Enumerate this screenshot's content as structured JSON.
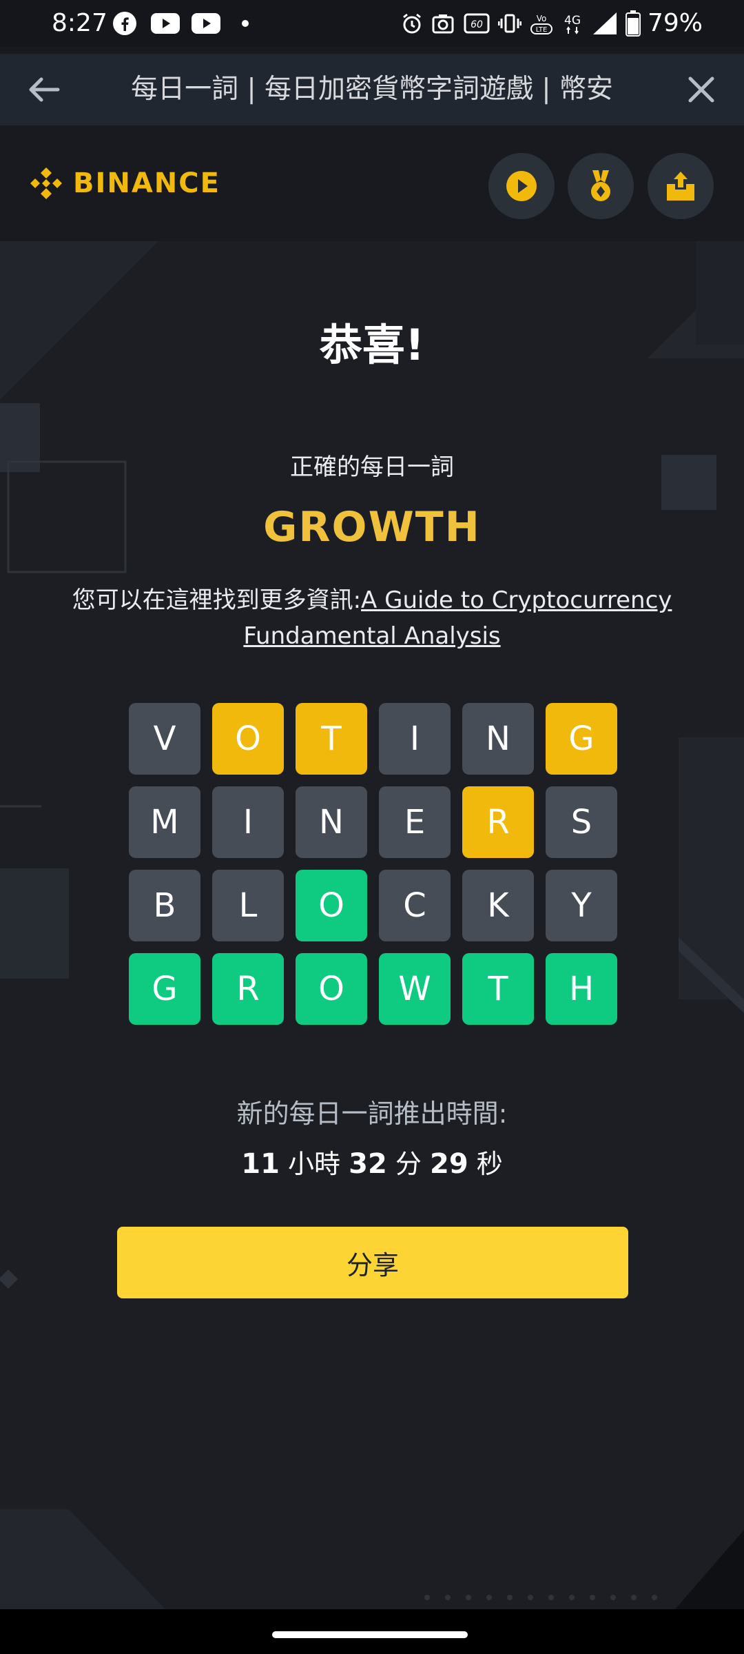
{
  "status_bar": {
    "time": "8:27",
    "battery_percent": "79%",
    "network": "4G",
    "refresh_rate": "60",
    "icons": [
      "facebook-icon",
      "youtube-icon",
      "youtube-icon",
      "dot-icon",
      "alarm-icon",
      "camera-icon",
      "refresh-rate-icon",
      "vibrate-icon",
      "volte-icon",
      "signal-icon",
      "battery-icon"
    ]
  },
  "nav": {
    "title": "每日一詞 | 每日加密貨幣字詞遊戲 | 幣安",
    "back_icon": "arrow-left-icon",
    "close_icon": "close-icon"
  },
  "header": {
    "logo_text": "BINANCE",
    "brand_color": "#f0b90b",
    "buttons": [
      "play-icon",
      "medal-icon",
      "share-upload-icon"
    ]
  },
  "result": {
    "congrats": "恭喜!",
    "subtitle": "正確的每日一詞",
    "answer": "GROWTH",
    "more_info_prefix": "您可以在這裡找到更多資訊:",
    "more_info_link": "A Guide to Cryptocurrency Fundamental Analysis"
  },
  "grid": {
    "rows": [
      [
        {
          "l": "V",
          "s": "absent"
        },
        {
          "l": "O",
          "s": "present"
        },
        {
          "l": "T",
          "s": "present"
        },
        {
          "l": "I",
          "s": "absent"
        },
        {
          "l": "N",
          "s": "absent"
        },
        {
          "l": "G",
          "s": "present"
        }
      ],
      [
        {
          "l": "M",
          "s": "absent"
        },
        {
          "l": "I",
          "s": "absent"
        },
        {
          "l": "N",
          "s": "absent"
        },
        {
          "l": "E",
          "s": "absent"
        },
        {
          "l": "R",
          "s": "present"
        },
        {
          "l": "S",
          "s": "absent"
        }
      ],
      [
        {
          "l": "B",
          "s": "absent"
        },
        {
          "l": "L",
          "s": "absent"
        },
        {
          "l": "O",
          "s": "correct"
        },
        {
          "l": "C",
          "s": "absent"
        },
        {
          "l": "K",
          "s": "absent"
        },
        {
          "l": "Y",
          "s": "absent"
        }
      ],
      [
        {
          "l": "G",
          "s": "correct"
        },
        {
          "l": "R",
          "s": "correct"
        },
        {
          "l": "O",
          "s": "correct"
        },
        {
          "l": "W",
          "s": "correct"
        },
        {
          "l": "T",
          "s": "correct"
        },
        {
          "l": "H",
          "s": "correct"
        }
      ]
    ],
    "colors": {
      "absent": "#474d57",
      "present": "#f0b90b",
      "correct": "#0ecb81"
    }
  },
  "next_word": {
    "label": "新的每日一詞推出時間:",
    "hours": "11",
    "hours_unit": "小時",
    "minutes": "32",
    "minutes_unit": "分",
    "seconds": "29",
    "seconds_unit": "秒"
  },
  "share_button": {
    "label": "分享",
    "color": "#fcd535"
  }
}
